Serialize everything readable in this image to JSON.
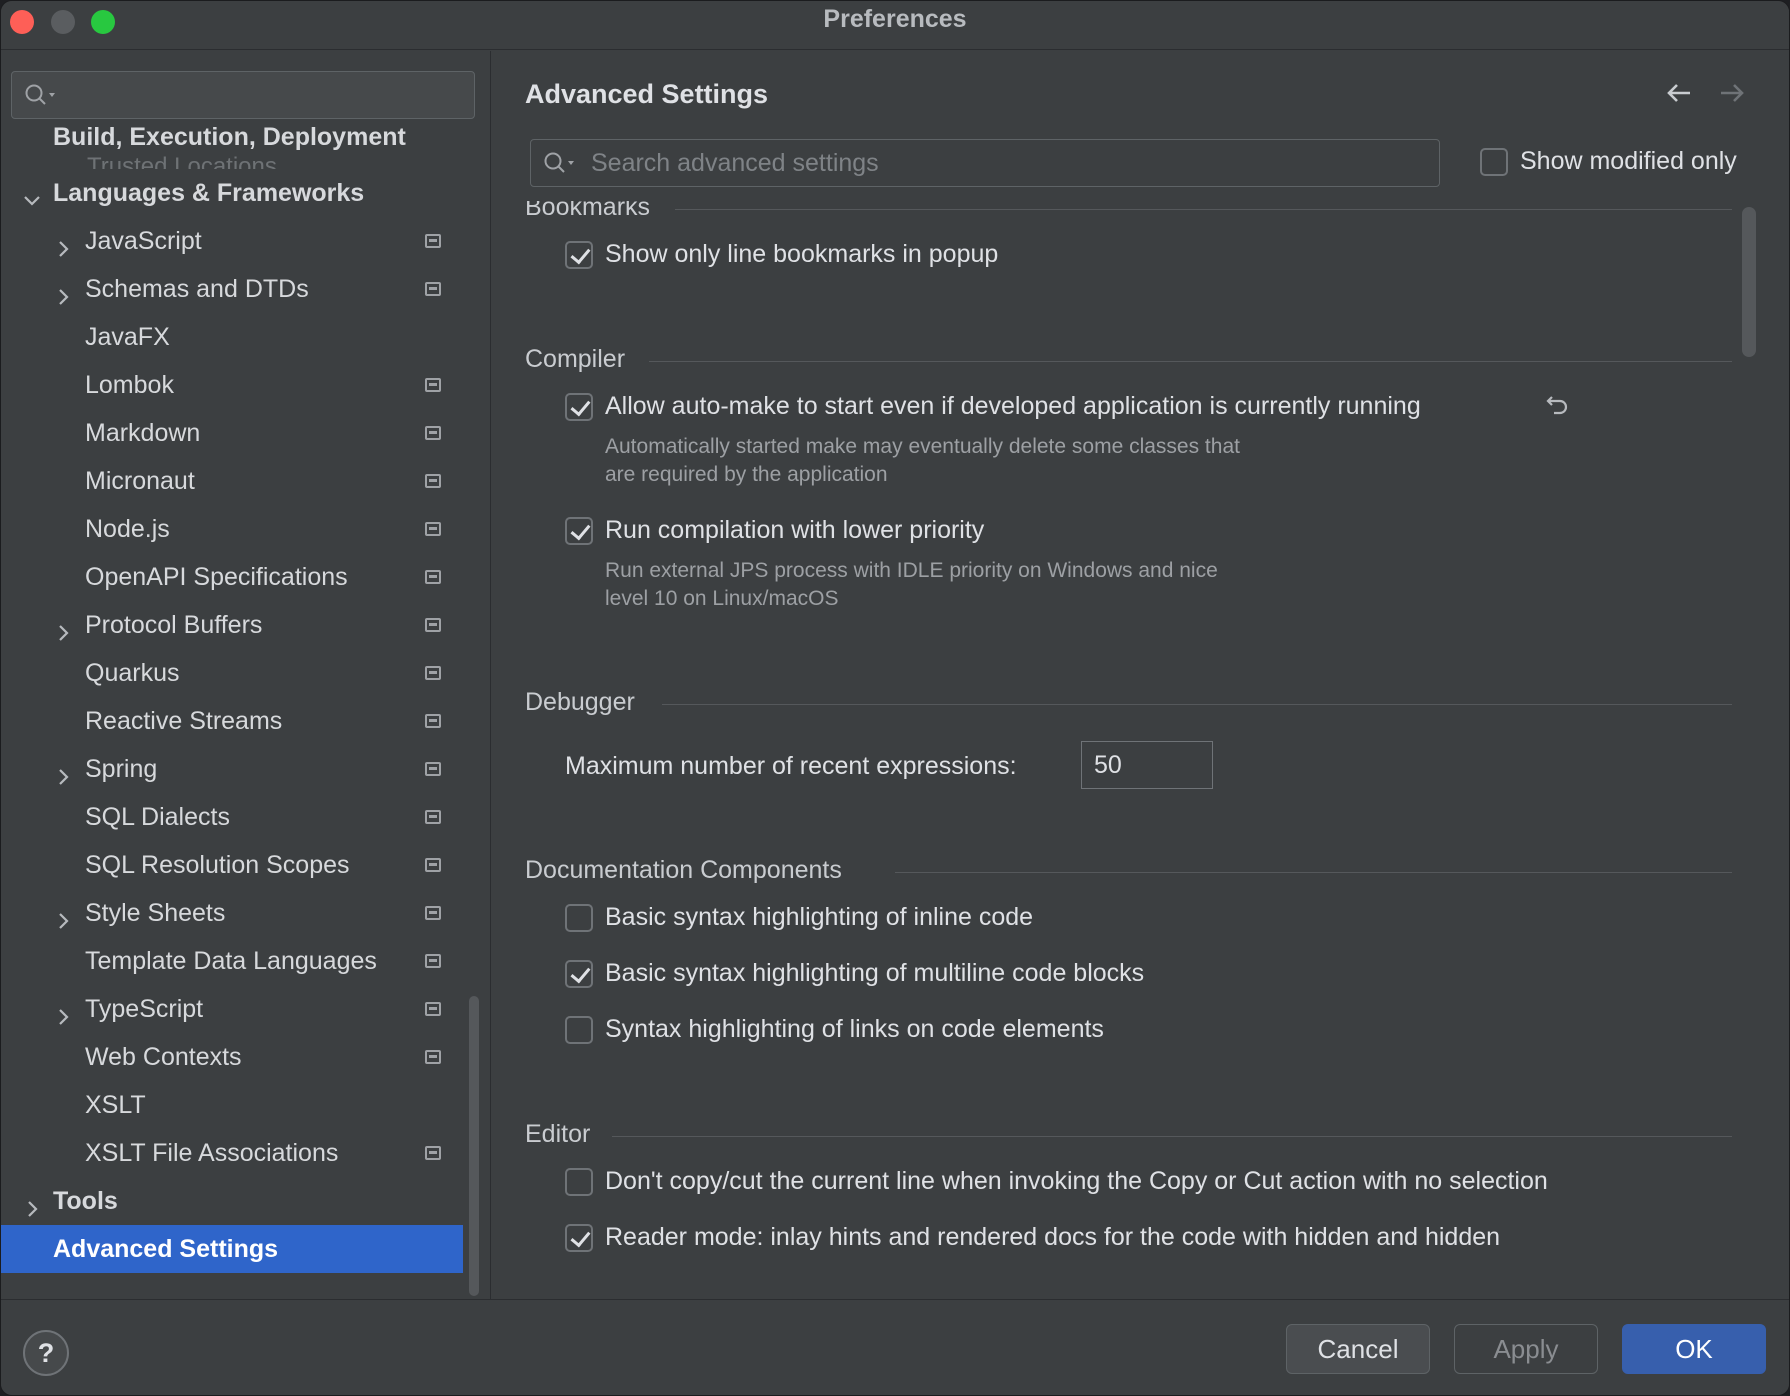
{
  "window": {
    "title": "Preferences"
  },
  "sidebar": {
    "search_placeholder": "",
    "ghost_label": "Trusted Locations",
    "items": [
      {
        "label": "Build, Execution, Deployment",
        "bold": true
      },
      {
        "label": "Languages & Frameworks",
        "bold": true,
        "expanded": true
      },
      {
        "label": "JavaScript",
        "expandable": true,
        "configurable": true
      },
      {
        "label": "Schemas and DTDs",
        "expandable": true,
        "configurable": true
      },
      {
        "label": "JavaFX"
      },
      {
        "label": "Lombok",
        "configurable": true
      },
      {
        "label": "Markdown",
        "configurable": true
      },
      {
        "label": "Micronaut",
        "configurable": true
      },
      {
        "label": "Node.js",
        "configurable": true
      },
      {
        "label": "OpenAPI Specifications",
        "configurable": true
      },
      {
        "label": "Protocol Buffers",
        "expandable": true,
        "configurable": true
      },
      {
        "label": "Quarkus",
        "configurable": true
      },
      {
        "label": "Reactive Streams",
        "configurable": true
      },
      {
        "label": "Spring",
        "expandable": true,
        "configurable": true
      },
      {
        "label": "SQL Dialects",
        "configurable": true
      },
      {
        "label": "SQL Resolution Scopes",
        "configurable": true
      },
      {
        "label": "Style Sheets",
        "expandable": true,
        "configurable": true
      },
      {
        "label": "Template Data Languages",
        "configurable": true
      },
      {
        "label": "TypeScript",
        "expandable": true,
        "configurable": true
      },
      {
        "label": "Web Contexts",
        "configurable": true
      },
      {
        "label": "XSLT"
      },
      {
        "label": "XSLT File Associations",
        "configurable": true
      },
      {
        "label": "Tools",
        "bold": true
      },
      {
        "label": "Advanced Settings",
        "bold": true,
        "selected": true
      }
    ]
  },
  "main": {
    "title": "Advanced Settings",
    "search_placeholder": "Search advanced settings",
    "show_modified_only": {
      "label": "Show modified only",
      "checked": false
    },
    "sections": {
      "bookmarks": {
        "title": "Bookmarks",
        "items": [
          {
            "label": "Show only line bookmarks in popup",
            "checked": true
          }
        ]
      },
      "compiler": {
        "title": "Compiler",
        "items": [
          {
            "label": "Allow auto-make to start even if developed application is currently running",
            "checked": true,
            "hint_line1": "Automatically started make may eventually delete some classes that",
            "hint_line2": "are required by the application"
          },
          {
            "label": "Run compilation with lower priority",
            "checked": true,
            "hint_line1": "Run external JPS process with IDLE priority on Windows and nice",
            "hint_line2": "level 10 on Linux/macOS"
          }
        ]
      },
      "debugger": {
        "title": "Debugger",
        "max_expr_label": "Maximum number of recent expressions:",
        "max_expr_value": "50"
      },
      "documentation": {
        "title": "Documentation Components",
        "items": [
          {
            "label": "Basic syntax highlighting of inline code",
            "checked": false
          },
          {
            "label": "Basic syntax highlighting of multiline code blocks",
            "checked": true
          },
          {
            "label": "Syntax highlighting of links on code elements",
            "checked": false
          }
        ]
      },
      "editor": {
        "title": "Editor",
        "items": [
          {
            "label": "Don't copy/cut the current line when invoking the Copy or Cut action with no selection",
            "checked": false
          },
          {
            "label": "Reader mode: inlay hints and rendered docs for the code with hidden and hidden",
            "checked": true
          }
        ]
      }
    }
  },
  "footer": {
    "help": "?",
    "cancel": "Cancel",
    "apply": "Apply",
    "ok": "OK"
  },
  "colors": {
    "accent": "#2f65ca",
    "primary_button": "#375fad",
    "background": "#3c3f41"
  }
}
